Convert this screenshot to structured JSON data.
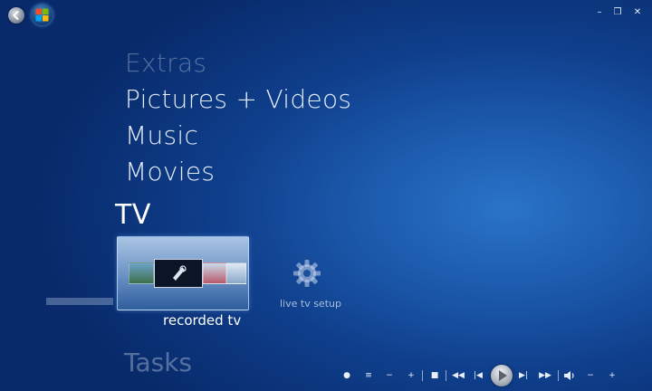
{
  "menu": {
    "items": [
      {
        "label": "Extras",
        "faded": true
      },
      {
        "label": "Pictures + Videos",
        "faded": false
      },
      {
        "label": "Music",
        "faded": false
      },
      {
        "label": "Movies",
        "faded": false
      }
    ],
    "section_title": "TV",
    "next_item": "Tasks"
  },
  "tv": {
    "recorded_tv_label": "recorded tv",
    "live_tv_setup_label": "live tv setup"
  },
  "window_controls": {
    "minimize": "–",
    "restore": "❐",
    "close": "✕"
  },
  "transport": {
    "record": "●",
    "list": "≡",
    "ch_minus": "−",
    "ch_plus": "+",
    "stop": "■",
    "rewind": "◀◀",
    "prev": "|◀",
    "next": "▶|",
    "fast_forward": "▶▶",
    "mute": "🔈",
    "vol_minus": "−",
    "vol_plus": "+"
  },
  "colors": {
    "background": "#0f3f8c",
    "accent": "#2a74c8"
  }
}
